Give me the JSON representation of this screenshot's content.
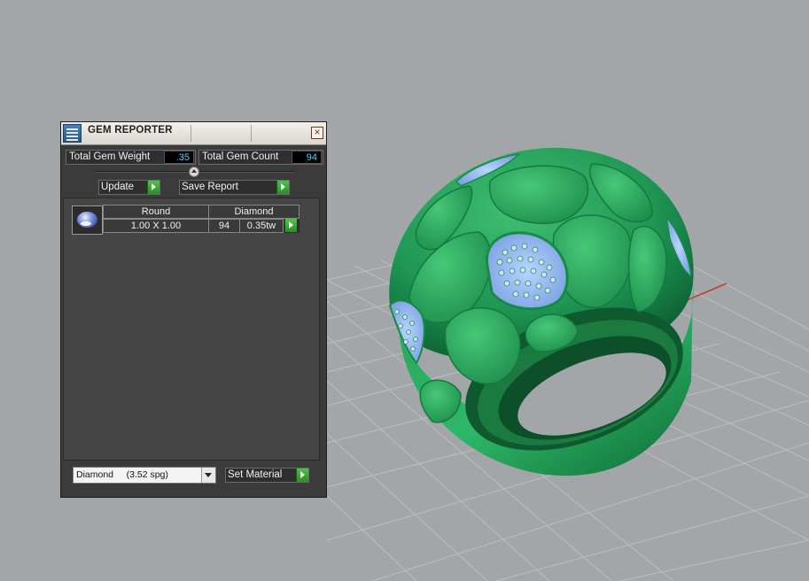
{
  "panel": {
    "title": "GEM REPORTER",
    "close_glyph": "×",
    "total_weight_label": "Total Gem Weight",
    "total_weight_value": ".35",
    "total_count_label": "Total Gem Count",
    "total_count_value": "94",
    "update_label": "Update",
    "save_report_label": "Save Report",
    "gem_row": {
      "shape": "Round",
      "material": "Diamond",
      "size": "1.00 X 1.00",
      "count": "94",
      "weight": "0.35tw"
    },
    "material_select_value": "Diamond     (3.52 spg)",
    "set_material_label": "Set Material"
  },
  "icons": {
    "app": "gem-reporter-app-icon",
    "close": "close-icon",
    "slider": "slider-handle-icon",
    "go": "play-arrow-icon",
    "gem": "round-gem-icon",
    "dropdown": "chevron-down-icon"
  },
  "colors": {
    "viewport_bg": "#a3a6a8",
    "panel_bg": "#3b3b3b",
    "value_text": "#55c8ff",
    "go_button": "#3aa836",
    "ring_green": "#23955a",
    "gem_blue": "#8fb4ee",
    "axis_red": "#c83a2a",
    "axis_green": "#3c8a3c"
  }
}
